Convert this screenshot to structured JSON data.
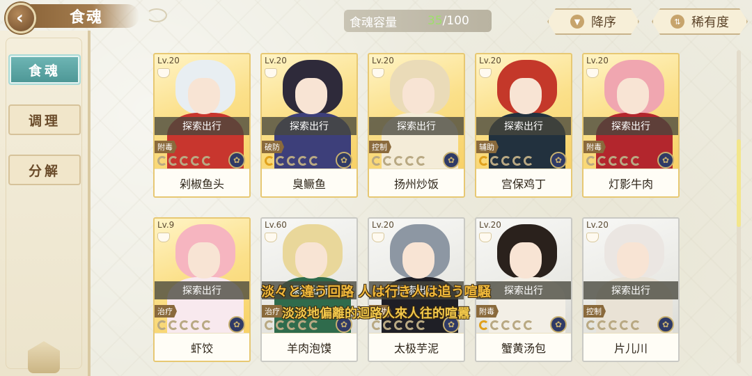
{
  "header": {
    "back_label": "‹",
    "title": "食魂",
    "capacity_label": "食魂容量",
    "capacity_current": "35",
    "capacity_max": "/100",
    "sort_desc_label": "降序",
    "sort_rarity_label": "稀有度"
  },
  "sidebar": {
    "items": [
      {
        "label": "食魂",
        "active": true
      },
      {
        "label": "调理",
        "active": false
      },
      {
        "label": "分解",
        "active": false
      }
    ]
  },
  "cards": [
    {
      "level": "Lv.20",
      "status": "探索出行",
      "role": "附毒",
      "name": "剁椒鱼头",
      "rings_on": 0,
      "frame": "gold",
      "hair": "#e8eef2",
      "cloth": "#c8362e"
    },
    {
      "level": "Lv.20",
      "status": "探索出行",
      "role": "破防",
      "name": "臭鳜鱼",
      "rings_on": 1,
      "frame": "gold",
      "hair": "#2e2a3a",
      "cloth": "#3d3f7a"
    },
    {
      "level": "Lv.20",
      "status": "探索出行",
      "role": "控制",
      "name": "扬州炒饭",
      "rings_on": 0,
      "frame": "gold",
      "hair": "#eadbb8",
      "cloth": "#f4ecd8"
    },
    {
      "level": "Lv.20",
      "status": "探索出行",
      "role": "辅助",
      "name": "宫保鸡丁",
      "rings_on": 1,
      "frame": "gold",
      "hair": "#c4382a",
      "cloth": "#22313e"
    },
    {
      "level": "Lv.20",
      "status": "探索出行",
      "role": "附毒",
      "name": "灯影牛肉",
      "rings_on": 0,
      "frame": "gold",
      "hair": "#f0a6b0",
      "cloth": "#b3262d"
    },
    {
      "level": "Lv.9",
      "status": "探索出行",
      "role": "治疗",
      "name": "虾饺",
      "rings_on": 0,
      "frame": "gold",
      "hair": "#f6b5c0",
      "cloth": "#f8e9ee"
    },
    {
      "level": "Lv.60",
      "status": "探索出行",
      "role": "治疗",
      "name": "羊肉泡馍",
      "rings_on": 0,
      "frame": "silver",
      "hair": "#e9d79a",
      "cloth": "#2f6b4c"
    },
    {
      "level": "Lv.20",
      "status": "探索出行",
      "role": "辅助",
      "name": "太极芋泥",
      "rings_on": 0,
      "frame": "silver",
      "hair": "#8d97a3",
      "cloth": "#1f1f26"
    },
    {
      "level": "Lv.20",
      "status": "探索出行",
      "role": "附毒",
      "name": "蟹黄汤包",
      "rings_on": 1,
      "frame": "silver",
      "hair": "#2a211c",
      "cloth": "#f3efe6"
    },
    {
      "level": "Lv.20",
      "status": "探索出行",
      "role": "控制",
      "name": "片儿川",
      "rings_on": 0,
      "frame": "silver",
      "hair": "#ebe6e2",
      "cloth": "#e9e2d5"
    }
  ],
  "subtitles": {
    "japanese": "淡々と違う回路 人は行き人は追う喧騒",
    "chinese": "淡淡地偏離的迴路人來人往的喧囂"
  },
  "colors": {
    "accent_teal": "#4c9695",
    "gold_frame": "#f6cc5a",
    "silver_frame": "#d4d4cf",
    "capacity_green": "#9ee06a",
    "subtitle_yellow": "#f1b93b"
  },
  "icons": {
    "back": "chevron-left-icon",
    "sort_desc": "triangle-down-icon",
    "sort_rarity": "sort-bars-icon",
    "food_bowl": "bowl-icon",
    "emblem": "flower-emblem-icon"
  }
}
